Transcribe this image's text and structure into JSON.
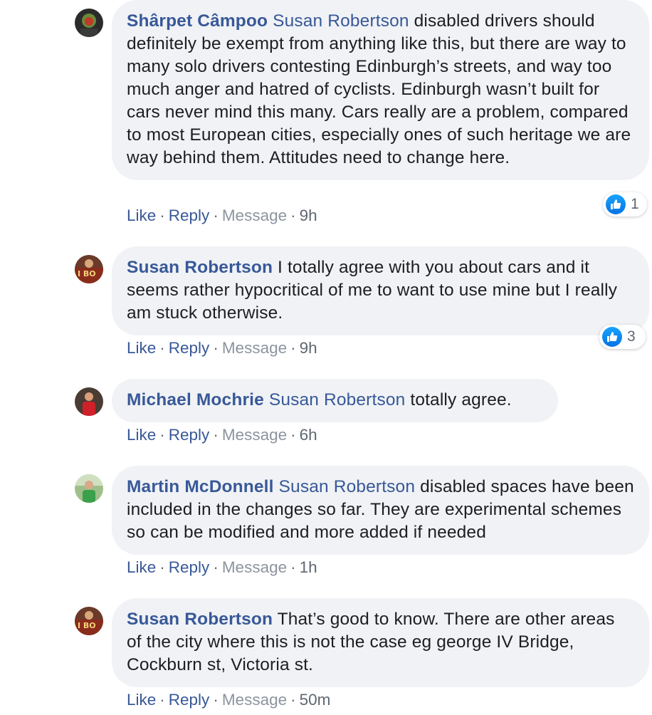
{
  "actions": {
    "like": "Like",
    "reply": "Reply",
    "message": "Message",
    "separator": "·"
  },
  "comments": [
    {
      "author": "Shârpet Câmpoo",
      "mention": "Susan Robertson",
      "text": " disabled drivers should definitely be exempt from anything like this, but there are way to many solo drivers contesting Edinburgh’s streets, and way too much anger and hatred of cyclists. Edinburgh wasn’t built for cars never mind this many. Cars really are a problem, compared to most European cities, especially ones of such heritage we are way behind them. Attitudes need to change here.",
      "time": "9h",
      "reaction_count": "1"
    },
    {
      "author": "Susan Robertson",
      "mention": "",
      "text": " I totally agree with you about cars and it seems rather hypocritical of me to want to use mine but I really am stuck otherwise.",
      "time": "9h",
      "reaction_count": "3"
    },
    {
      "author": "Michael Mochrie",
      "mention": "Susan Robertson",
      "text": " totally agree.",
      "time": "6h"
    },
    {
      "author": "Martin McDonnell",
      "mention": "Susan Robertson",
      "text": " disabled spaces have been included in the changes so far. They are experimental schemes so can be modified and more added if needed",
      "time": "1h"
    },
    {
      "author": "Susan Robertson",
      "mention": "",
      "text": " That’s good to know. There are other areas of the city where this is not the case eg george IV Bridge, Cockburn st, Victoria st.",
      "time": "50m"
    }
  ],
  "colors": {
    "name_link": "#385898",
    "bubble_bg": "#f0f2f5",
    "like_blue": "#1877f2"
  },
  "icons": {
    "reaction": "thumbs-up-icon"
  }
}
